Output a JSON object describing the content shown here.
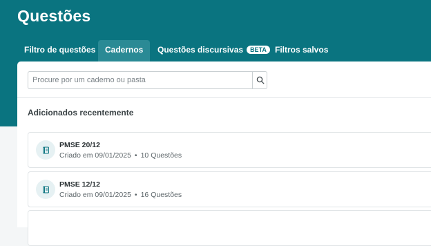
{
  "header": {
    "title": "Questões"
  },
  "tabs": [
    {
      "label": "Filtro de questões",
      "active": false
    },
    {
      "label": "Cadernos",
      "active": true
    },
    {
      "label": "Questões discursivas",
      "badge": "BETA",
      "active": false
    },
    {
      "label": "Filtros salvos",
      "active": false
    }
  ],
  "search": {
    "placeholder": "Procure por um caderno ou pasta",
    "value": "",
    "icon": "search-icon"
  },
  "recent": {
    "title": "Adicionados recentemente",
    "items": [
      {
        "name": "PMSE 20/12",
        "created": "Criado em 09/01/2025",
        "count": "10 Questões",
        "icon": "notebook-icon"
      },
      {
        "name": "PMSE 12/12",
        "created": "Criado em 09/01/2025",
        "count": "16 Questões",
        "icon": "notebook-icon"
      }
    ],
    "separator": "•"
  },
  "colors": {
    "header": "#0a7480",
    "accent": "#0a7480",
    "icon_bg": "#e6f1f3"
  }
}
